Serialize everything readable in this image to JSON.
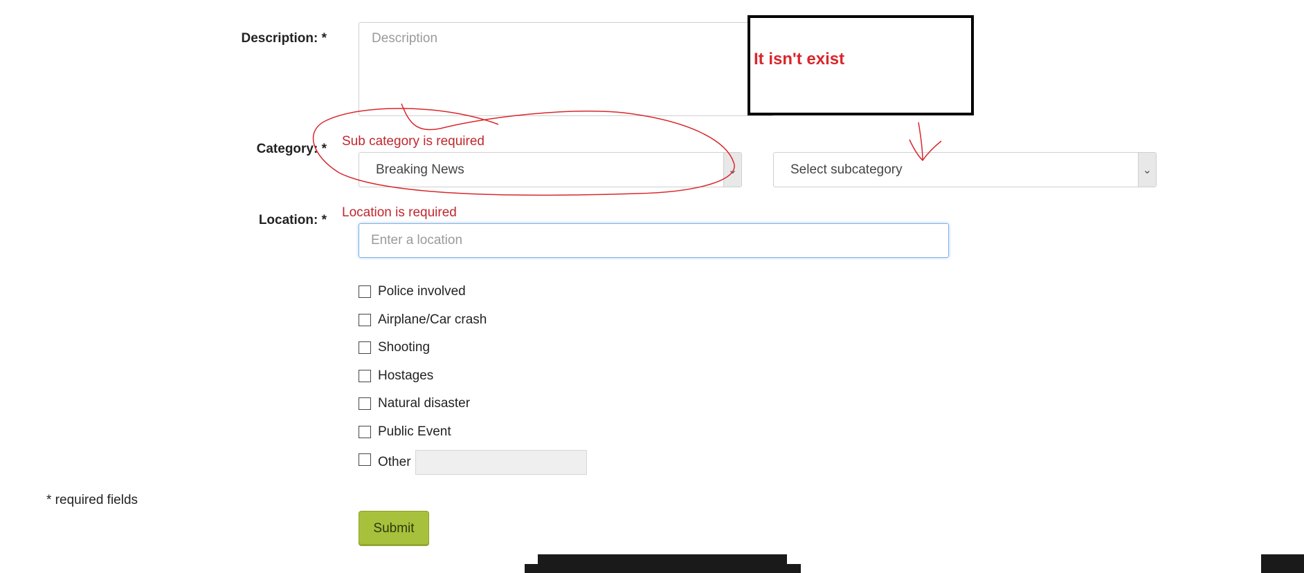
{
  "form": {
    "description": {
      "label": "Description: *",
      "placeholder": "Description"
    },
    "category": {
      "label": "Category: *",
      "error": "Sub category is required",
      "selected": "Breaking News",
      "subcategory_placeholder": "Select subcategory"
    },
    "location": {
      "label": "Location: *",
      "error": "Location is required",
      "placeholder": "Enter a location"
    },
    "checkboxes": [
      {
        "label": "Police involved",
        "checked": false
      },
      {
        "label": "Airplane/Car crash",
        "checked": false
      },
      {
        "label": "Shooting",
        "checked": false
      },
      {
        "label": "Hostages",
        "checked": false
      },
      {
        "label": "Natural disaster",
        "checked": false
      },
      {
        "label": "Public Event",
        "checked": false
      },
      {
        "label": "Other",
        "checked": false
      }
    ],
    "required_note": "* required fields",
    "submit_label": "Submit"
  },
  "annotation": {
    "note": "It isn't exist",
    "ink_color": "#d9262c"
  }
}
